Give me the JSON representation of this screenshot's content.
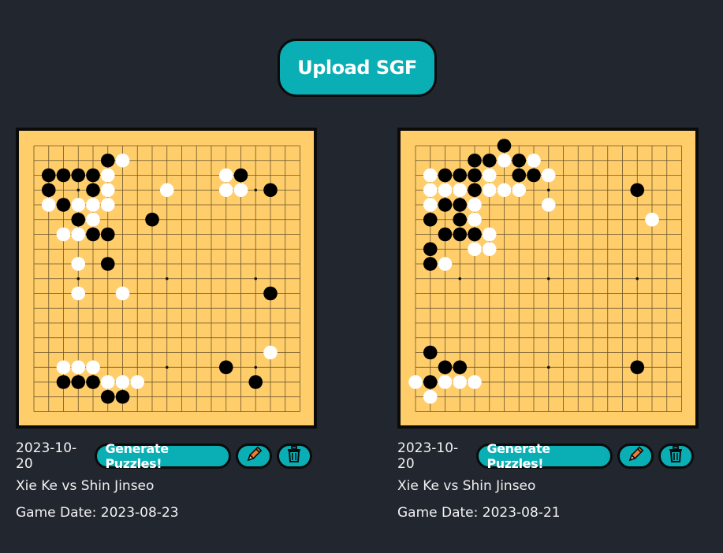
{
  "upload_label": "Upload SGF",
  "colors": {
    "background": "#22262e",
    "accent": "#0aaeb5",
    "board": "#ffcd6a",
    "pencil": "#f07c2c",
    "trash": "#0b0b0b"
  },
  "icons": {
    "edit": "pencil-icon",
    "delete": "trash-icon"
  },
  "games": [
    {
      "created": "2023-10-20",
      "generate_label": "Generate Puzzles!",
      "players": "Xie Ke vs Shin Jinseo",
      "game_date": "Game Date: 2023-08-23",
      "black": [
        [
          5,
          1
        ],
        [
          1,
          2
        ],
        [
          2,
          2
        ],
        [
          3,
          2
        ],
        [
          4,
          2
        ],
        [
          14,
          2
        ],
        [
          1,
          3
        ],
        [
          4,
          3
        ],
        [
          16,
          3
        ],
        [
          2,
          4
        ],
        [
          3,
          5
        ],
        [
          8,
          5
        ],
        [
          4,
          6
        ],
        [
          5,
          6
        ],
        [
          5,
          8
        ],
        [
          16,
          10
        ],
        [
          13,
          15
        ],
        [
          2,
          16
        ],
        [
          3,
          16
        ],
        [
          4,
          16
        ],
        [
          15,
          16
        ],
        [
          5,
          17
        ],
        [
          6,
          17
        ]
      ],
      "white": [
        [
          6,
          1
        ],
        [
          5,
          2
        ],
        [
          13,
          2
        ],
        [
          5,
          3
        ],
        [
          9,
          3
        ],
        [
          13,
          3
        ],
        [
          14,
          3
        ],
        [
          1,
          4
        ],
        [
          3,
          4
        ],
        [
          4,
          4
        ],
        [
          5,
          4
        ],
        [
          4,
          5
        ],
        [
          2,
          6
        ],
        [
          3,
          6
        ],
        [
          3,
          8
        ],
        [
          3,
          10
        ],
        [
          6,
          10
        ],
        [
          16,
          14
        ],
        [
          2,
          15
        ],
        [
          3,
          15
        ],
        [
          4,
          15
        ],
        [
          5,
          16
        ],
        [
          6,
          16
        ],
        [
          7,
          16
        ]
      ]
    },
    {
      "created": "2023-10-20",
      "generate_label": "Generate Puzzles!",
      "players": "Xie Ke vs Shin Jinseo",
      "game_date": "Game Date: 2023-08-21",
      "black": [
        [
          6,
          0
        ],
        [
          4,
          1
        ],
        [
          5,
          1
        ],
        [
          7,
          1
        ],
        [
          2,
          2
        ],
        [
          3,
          2
        ],
        [
          4,
          2
        ],
        [
          7,
          2
        ],
        [
          8,
          2
        ],
        [
          4,
          3
        ],
        [
          15,
          3
        ],
        [
          2,
          4
        ],
        [
          3,
          4
        ],
        [
          1,
          5
        ],
        [
          3,
          5
        ],
        [
          2,
          6
        ],
        [
          3,
          6
        ],
        [
          4,
          6
        ],
        [
          1,
          7
        ],
        [
          1,
          8
        ],
        [
          1,
          14
        ],
        [
          2,
          15
        ],
        [
          3,
          15
        ],
        [
          15,
          15
        ],
        [
          1,
          16
        ]
      ],
      "white": [
        [
          8,
          1
        ],
        [
          6,
          1
        ],
        [
          1,
          2
        ],
        [
          5,
          2
        ],
        [
          9,
          2
        ],
        [
          1,
          3
        ],
        [
          2,
          3
        ],
        [
          3,
          3
        ],
        [
          5,
          3
        ],
        [
          6,
          3
        ],
        [
          7,
          3
        ],
        [
          1,
          4
        ],
        [
          4,
          4
        ],
        [
          9,
          4
        ],
        [
          4,
          5
        ],
        [
          16,
          5
        ],
        [
          5,
          6
        ],
        [
          4,
          7
        ],
        [
          5,
          7
        ],
        [
          2,
          8
        ],
        [
          0,
          16
        ],
        [
          2,
          16
        ],
        [
          3,
          16
        ],
        [
          4,
          16
        ],
        [
          1,
          17
        ]
      ]
    }
  ]
}
